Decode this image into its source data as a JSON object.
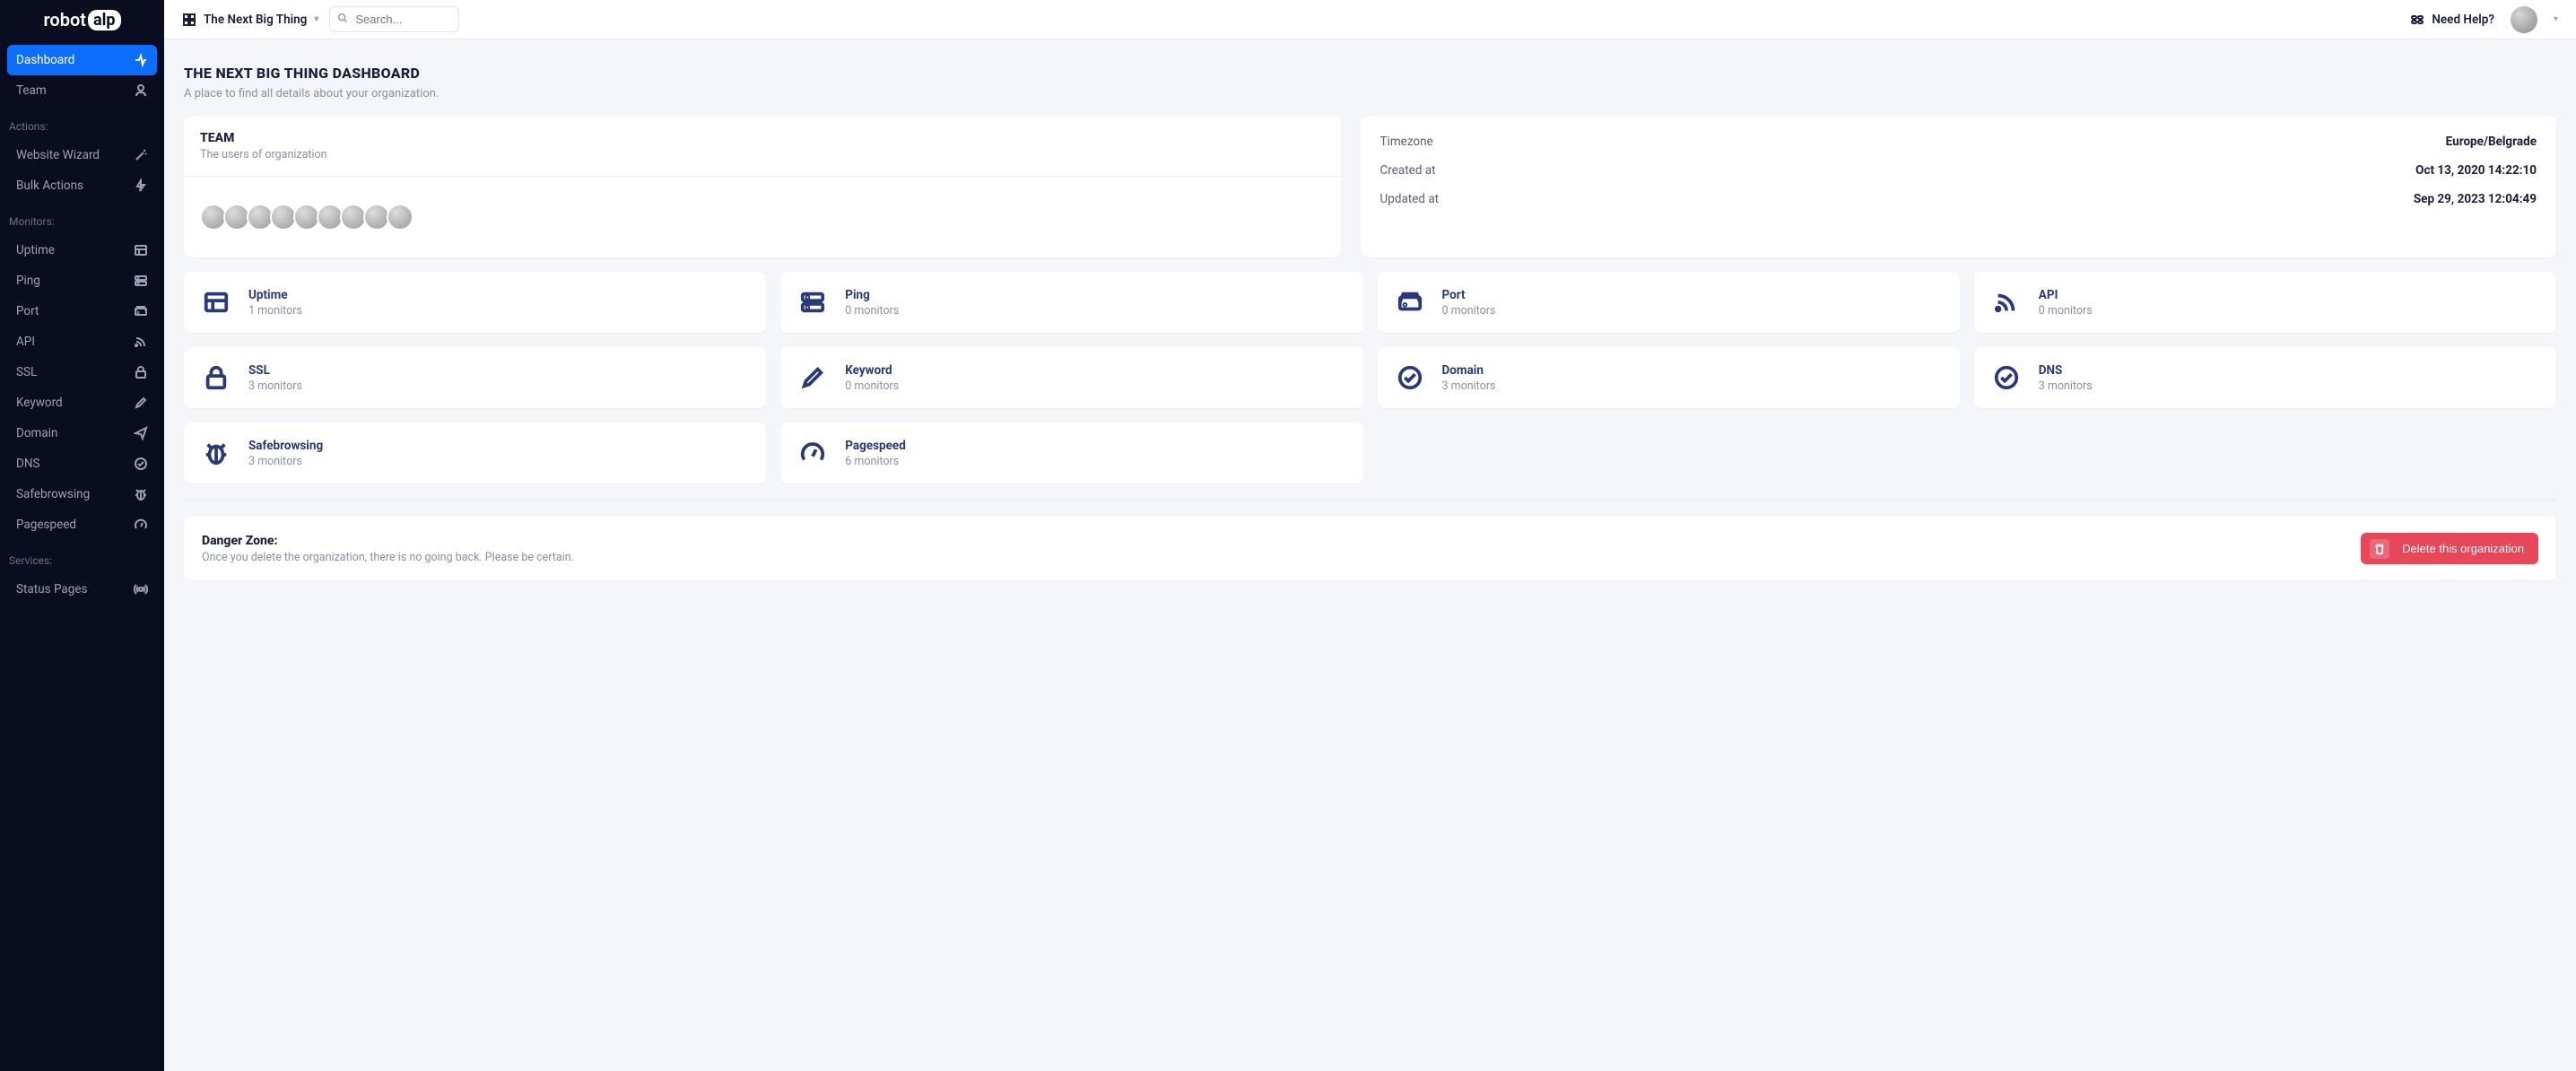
{
  "brand": {
    "prefix": "robot",
    "badge": "alp"
  },
  "sidebar": {
    "main": [
      {
        "label": "Dashboard",
        "icon": "activity",
        "active": true
      },
      {
        "label": "Team",
        "icon": "user",
        "active": false
      }
    ],
    "sections": [
      {
        "title": "Actions:",
        "items": [
          {
            "label": "Website Wizard",
            "icon": "wand"
          },
          {
            "label": "Bulk Actions",
            "icon": "zap"
          }
        ]
      },
      {
        "title": "Monitors:",
        "items": [
          {
            "label": "Uptime",
            "icon": "layout"
          },
          {
            "label": "Ping",
            "icon": "server"
          },
          {
            "label": "Port",
            "icon": "hdd"
          },
          {
            "label": "API",
            "icon": "rss"
          },
          {
            "label": "SSL",
            "icon": "lock"
          },
          {
            "label": "Keyword",
            "icon": "pen"
          },
          {
            "label": "Domain",
            "icon": "send"
          },
          {
            "label": "DNS",
            "icon": "check-circle"
          },
          {
            "label": "Safebrowsing",
            "icon": "bug"
          },
          {
            "label": "Pagespeed",
            "icon": "gauge"
          }
        ]
      },
      {
        "title": "Services:",
        "items": [
          {
            "label": "Status Pages",
            "icon": "broadcast"
          }
        ]
      }
    ]
  },
  "header": {
    "org_name": "The Next Big Thing",
    "search_placeholder": "Search...",
    "help_label": "Need Help?"
  },
  "page": {
    "title": "THE NEXT BIG THING DASHBOARD",
    "subtitle": "A place to find all details about your organization."
  },
  "team": {
    "title": "TEAM",
    "subtitle": "The users of organization",
    "member_count": 9
  },
  "meta": {
    "rows": [
      {
        "label": "Timezone",
        "value": "Europe/Belgrade"
      },
      {
        "label": "Created at",
        "value": "Oct 13, 2020 14:22:10"
      },
      {
        "label": "Updated at",
        "value": "Sep 29, 2023 12:04:49"
      }
    ]
  },
  "monitors": [
    {
      "name": "Uptime",
      "count": "1 monitors",
      "icon": "layout"
    },
    {
      "name": "Ping",
      "count": "0 monitors",
      "icon": "server"
    },
    {
      "name": "Port",
      "count": "0 monitors",
      "icon": "hdd"
    },
    {
      "name": "API",
      "count": "0 monitors",
      "icon": "rss"
    },
    {
      "name": "SSL",
      "count": "3 monitors",
      "icon": "lock"
    },
    {
      "name": "Keyword",
      "count": "0 monitors",
      "icon": "pen"
    },
    {
      "name": "Domain",
      "count": "3 monitors",
      "icon": "check-circle"
    },
    {
      "name": "DNS",
      "count": "3 monitors",
      "icon": "check-circle"
    },
    {
      "name": "Safebrowsing",
      "count": "3 monitors",
      "icon": "bug"
    },
    {
      "name": "Pagespeed",
      "count": "6 monitors",
      "icon": "gauge"
    }
  ],
  "danger": {
    "title": "Danger Zone:",
    "subtitle": "Once you delete the organization, there is no going back. Please be certain.",
    "button": "Delete this organization"
  }
}
